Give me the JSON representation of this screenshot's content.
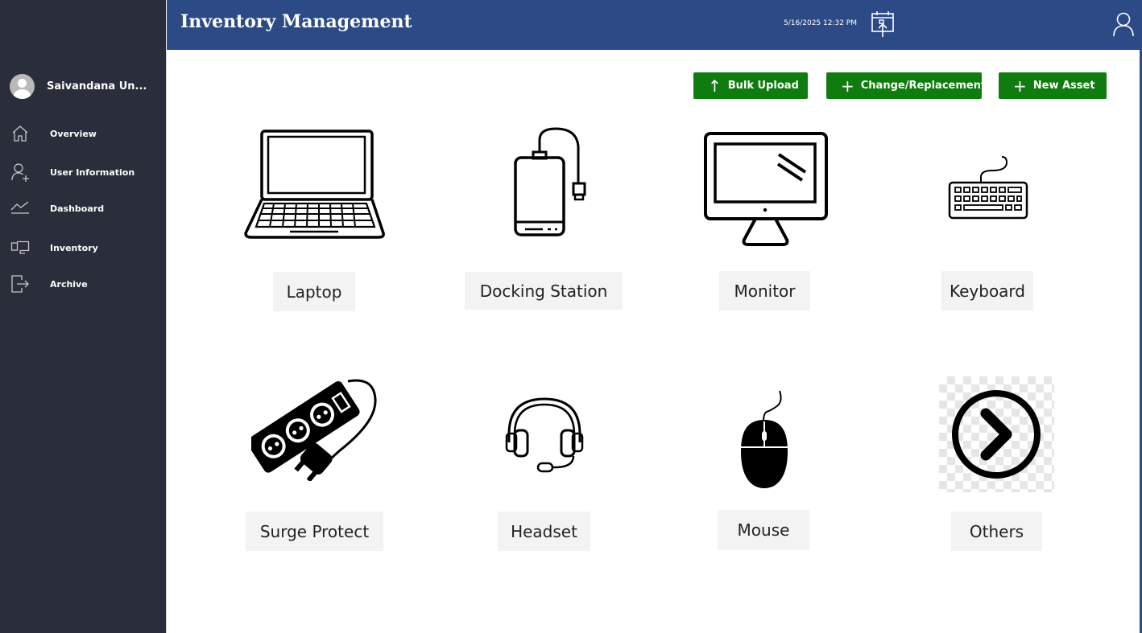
{
  "header": {
    "title": "Inventory Management",
    "datetime": "5/16/2025 12:32 PM",
    "calendar_icon": "calendar-upload-icon",
    "profile_icon": "user-profile-icon"
  },
  "sidebar": {
    "user_name": "Saivandana Un...",
    "items": [
      {
        "label": "Overview",
        "icon": "home-icon"
      },
      {
        "label": "User Information",
        "icon": "add-user-icon"
      },
      {
        "label": "Dashboard",
        "icon": "chart-line-icon"
      },
      {
        "label": "Inventory",
        "icon": "inventory-icon"
      },
      {
        "label": "Archive",
        "icon": "sign-out-icon"
      }
    ]
  },
  "actions": {
    "bulk_upload": "Bulk Upload",
    "change_replacement": "Change/Replacement",
    "new_asset": "New Asset"
  },
  "assets": [
    {
      "label": "Laptop",
      "icon": "laptop-icon"
    },
    {
      "label": "Docking Station",
      "icon": "docking-station-icon"
    },
    {
      "label": "Monitor",
      "icon": "monitor-icon"
    },
    {
      "label": "Keyboard",
      "icon": "keyboard-icon"
    },
    {
      "label": "Surge Protect",
      "icon": "surge-protector-icon"
    },
    {
      "label": "Headset",
      "icon": "headset-icon"
    },
    {
      "label": "Mouse",
      "icon": "mouse-icon"
    },
    {
      "label": "Others",
      "icon": "chevron-right-circle-icon"
    }
  ],
  "colors": {
    "sidebar_bg": "#2a2d3a",
    "header_bg": "#2c4a86",
    "button_green": "#107c10",
    "label_bg": "#f3f3f3"
  }
}
